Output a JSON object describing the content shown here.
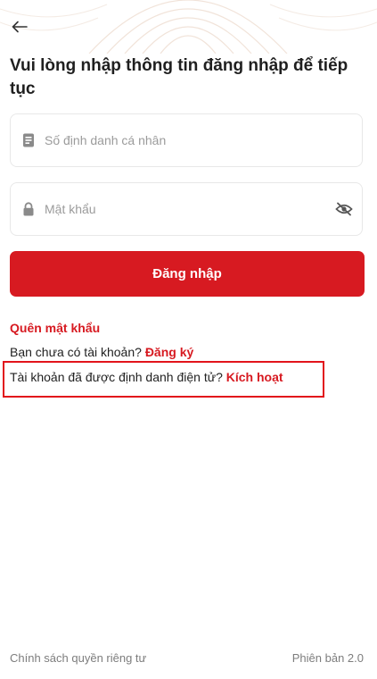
{
  "header": {
    "back_icon": "arrow-left-icon"
  },
  "title": "Vui lòng nhập thông tin đăng nhập để tiếp tục",
  "id_field": {
    "icon": "id-card-icon",
    "placeholder": "Số định danh cá nhân",
    "value": ""
  },
  "password_field": {
    "icon": "lock-icon",
    "placeholder": "Mật khẩu",
    "value": "",
    "toggle_icon": "eye-off-icon"
  },
  "login_button": {
    "label": "Đăng nhập"
  },
  "forgot_password": "Quên mật khẩu",
  "register": {
    "prompt": "Bạn chưa có tài khoản?",
    "link": "Đăng ký"
  },
  "activate": {
    "prompt": "Tài khoản đã được định danh điện tử?",
    "link": "Kích hoạt"
  },
  "footer": {
    "privacy": "Chính sách quyền riêng tư",
    "version": "Phiên bản 2.0"
  },
  "colors": {
    "accent": "#d71a21",
    "highlight_box": "#e2141b",
    "title_text": "#1f1f1f",
    "muted_text": "#7d7d7d"
  }
}
